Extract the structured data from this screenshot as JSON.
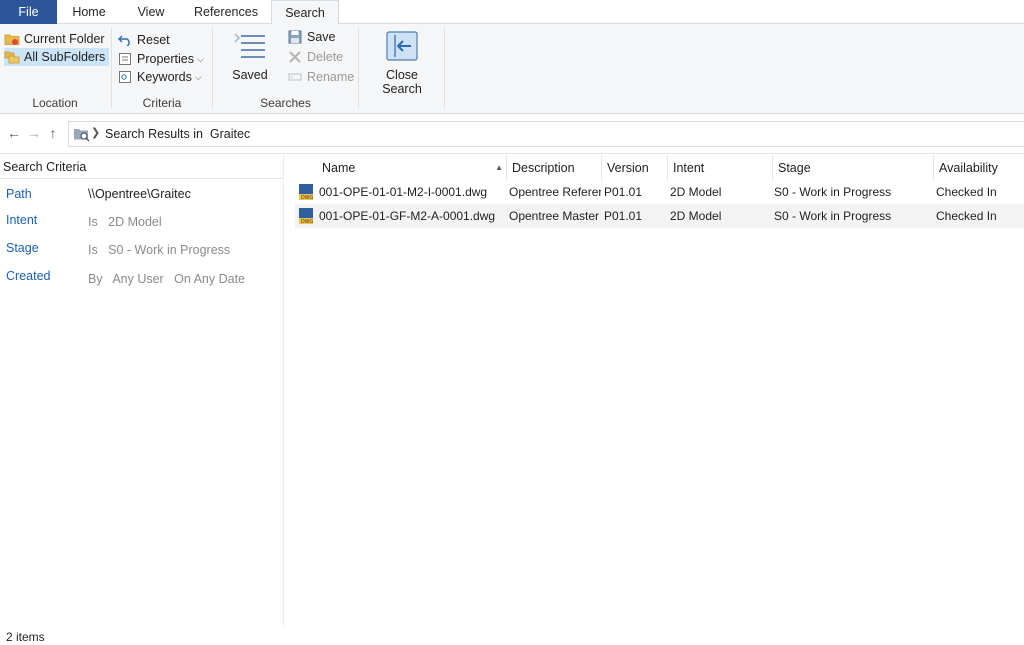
{
  "tabs": {
    "file": "File",
    "home": "Home",
    "view": "View",
    "references": "References",
    "search": "Search"
  },
  "ribbon": {
    "location": {
      "label": "Location",
      "current_folder": "Current Folder",
      "all_subfolders": "All SubFolders"
    },
    "criteria": {
      "label": "Criteria",
      "reset": "Reset",
      "properties": "Properties",
      "keywords": "Keywords"
    },
    "searches": {
      "label": "Searches",
      "saved": "Saved",
      "save": "Save",
      "delete": "Delete",
      "rename": "Rename"
    },
    "close_search": "Close Search"
  },
  "address": {
    "text": "Search Results in  Graitec"
  },
  "search_criteria": {
    "header": "Search Criteria",
    "rows": [
      {
        "key": "Path",
        "value": "\\\\Opentree\\Graitec"
      },
      {
        "key": "Intent",
        "value": "Is   2D Model"
      },
      {
        "key": "Stage",
        "value": "Is   S0 - Work in Progress"
      },
      {
        "key": "Created",
        "value": "By   Any User   On Any Date"
      }
    ]
  },
  "columns": {
    "name": "Name",
    "description": "Description",
    "version": "Version",
    "intent": "Intent",
    "stage": "Stage",
    "availability": "Availability"
  },
  "rows": [
    {
      "name": "001-OPE-01-01-M2-I-0001.dwg",
      "description": "Opentree Referenc",
      "version": "P01.01",
      "intent": "2D Model",
      "stage": "S0 - Work in Progress",
      "availability": "Checked In"
    },
    {
      "name": "001-OPE-01-GF-M2-A-0001.dwg",
      "description": "Opentree Master D",
      "version": "P01.01",
      "intent": "2D Model",
      "stage": "S0 - Work in Progress",
      "availability": "Checked In"
    }
  ],
  "status": {
    "items": "2 items"
  }
}
